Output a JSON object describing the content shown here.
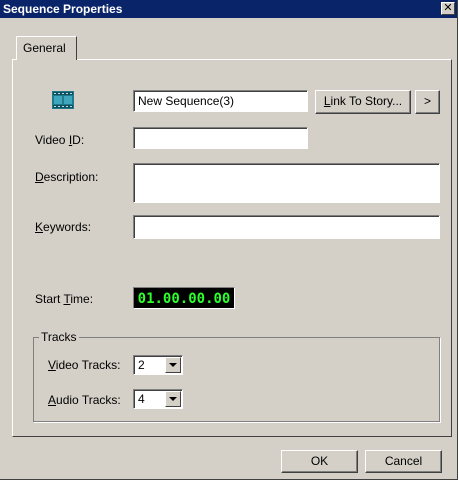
{
  "window": {
    "title": "Sequence Properties",
    "close_glyph": "✕"
  },
  "tabs": [
    {
      "label": "General"
    }
  ],
  "sequence": {
    "name_value": "New Sequence(3)",
    "link_button": {
      "prefix": "",
      "accel": "L",
      "rest": "ink To Story..."
    },
    "more_button": ">",
    "icon": "film-icon"
  },
  "video_id": {
    "pre": "Video ",
    "accel": "I",
    "post": "D:",
    "value": ""
  },
  "description": {
    "pre": "",
    "accel": "D",
    "post": "escription:",
    "value": ""
  },
  "keywords": {
    "pre": "",
    "accel": "K",
    "post": "eywords:",
    "value": ""
  },
  "start_time": {
    "pre": "Start ",
    "accel": "T",
    "post": "ime:",
    "value": "01.00.00.00"
  },
  "tracks": {
    "legend": "Tracks",
    "video": {
      "pre": "",
      "accel": "V",
      "post": "ideo Tracks:",
      "value": "2"
    },
    "audio": {
      "pre": "",
      "accel": "A",
      "post": "udio Tracks:",
      "value": "4"
    }
  },
  "footer": {
    "ok": "OK",
    "cancel": "Cancel"
  },
  "colors": {
    "titlebar": "#0a246a",
    "timecode_text": "#2dff2d",
    "timecode_bg": "#000000",
    "film_icon": "#1e7a8c"
  }
}
